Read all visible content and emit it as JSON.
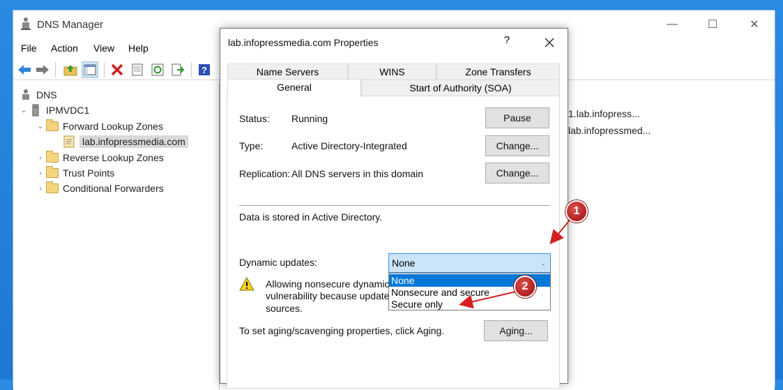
{
  "main_window": {
    "title": "DNS Manager",
    "controls": {
      "minimize": "—",
      "maximize": "☐",
      "close": "✕"
    }
  },
  "menu": [
    "File",
    "Action",
    "View",
    "Help"
  ],
  "tree": {
    "root": "DNS",
    "server": "IPMVDC1",
    "forward_zones": "Forward Lookup Zones",
    "zone": "lab.infopressmedia.com",
    "reverse_zones": "Reverse Lookup Zones",
    "trust_points": "Trust Points",
    "conditional_forwarders": "Conditional Forwarders"
  },
  "right_pane": {
    "row1": "1.lab.infopress...",
    "row2": "lab.infopressmed..."
  },
  "dialog": {
    "title": "lab.infopressmedia.com Properties",
    "help": "?",
    "close": "✕",
    "tabs_row1": [
      "Name Servers",
      "WINS",
      "Zone Transfers"
    ],
    "tabs_row2": [
      "General",
      "Start of Authority (SOA)"
    ],
    "status_label": "Status:",
    "status_value": "Running",
    "pause_button": "Pause",
    "type_label": "Type:",
    "type_value": "Active Directory-Integrated",
    "type_change_button": "Change...",
    "replication_label": "Replication:",
    "replication_value": "All DNS servers in this domain",
    "replication_change_button": "Change...",
    "storage_text": "Data is stored in Active Directory.",
    "dynamic_updates_label": "Dynamic updates:",
    "dynamic_updates_value": "None",
    "dynamic_updates_options": [
      "None",
      "Nonsecure and secure",
      "Secure only"
    ],
    "warning_line1": "Allowing nonsecure dynamic u",
    "warning_line2": "vulnerability because updates",
    "warning_line3": "sources.",
    "aging_text": "To set aging/scavenging properties, click Aging.",
    "aging_button": "Aging..."
  },
  "callouts": {
    "one": "1",
    "two": "2"
  },
  "colors": {
    "accent": "#0078d7",
    "badge": "#b01e1e",
    "arrow": "#d42020"
  }
}
